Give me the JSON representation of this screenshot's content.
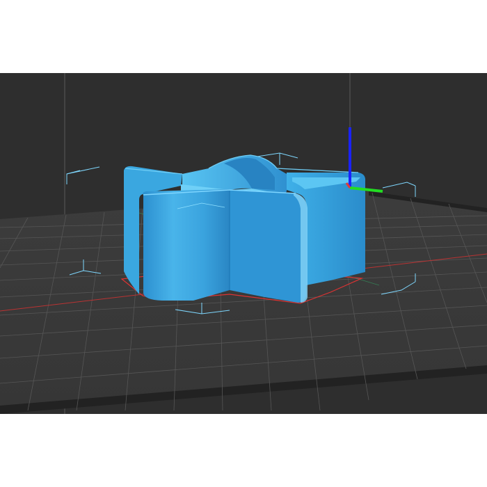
{
  "viewport": {
    "background_color": "#2e2e2e",
    "bed_color": "#3a3a3a",
    "bed_edge_color": "#1f1f1f",
    "grid_color": "#555555",
    "x_axis_color": "#e53935",
    "y_axis_color": "#2e7d32"
  },
  "model": {
    "shape": "five-point-star-cookie-cutter",
    "color": "#3aa7e0",
    "highlight_color": "#7fd0f5",
    "shadow_color": "#1f78b5",
    "selected": true
  },
  "selection_box": {
    "color": "#7fd8ff"
  },
  "axes_gizmo": {
    "z_color": "#1a22ff",
    "y_color": "#22dd22",
    "x_color": "#e53935"
  },
  "build_volume_lines": {
    "color": "#5a5a5a"
  }
}
